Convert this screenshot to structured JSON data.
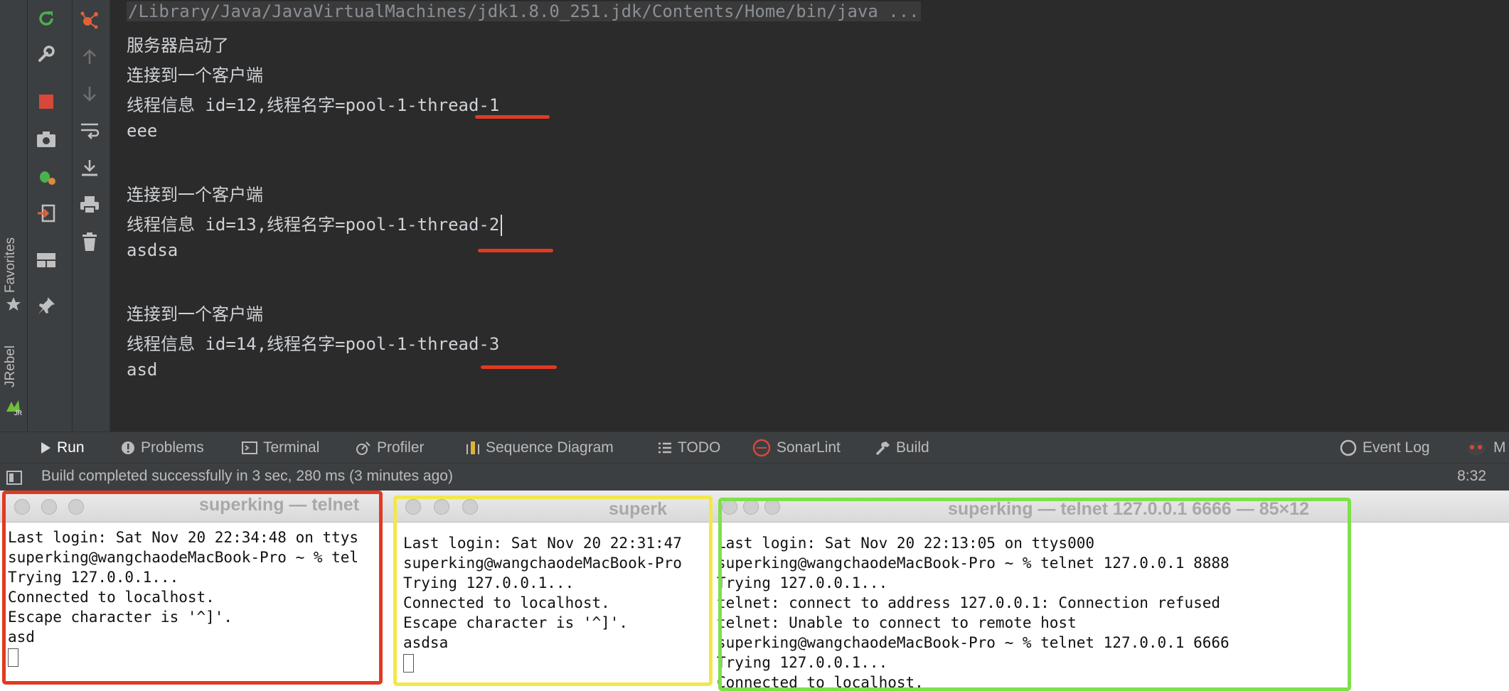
{
  "sidebar": {
    "favorites_label": "Favorites",
    "jrebel_label": "JRebel"
  },
  "console": {
    "command_line": "/Library/Java/JavaVirtualMachines/jdk1.8.0_251.jdk/Contents/Home/bin/java ...",
    "lines": [
      "服务器启动了",
      "连接到一个客户端",
      "线程信息 id=12,线程名字=pool-1-thread-1",
      "eee",
      "",
      "连接到一个客户端",
      "线程信息 id=13,线程名字=pool-1-thread-2",
      "asdsa",
      "",
      "连接到一个客户端",
      "线程信息 id=14,线程名字=pool-1-thread-3",
      "asd"
    ]
  },
  "tool_tabs": [
    "Run",
    "Problems",
    "Terminal",
    "Profiler",
    "Sequence Diagram",
    "TODO",
    "SonarLint",
    "Build"
  ],
  "right_tabs": [
    "Event Log",
    "M"
  ],
  "status": {
    "message": "Build completed successfully in 3 sec, 280 ms (3 minutes ago)",
    "time": "8:32"
  },
  "terminals": [
    {
      "title": "superking — telnet",
      "lines": [
        "Last login: Sat Nov 20 22:34:48 on ttys",
        "superking@wangchaodeMacBook-Pro ~ % tel",
        "Trying 127.0.0.1...",
        "Connected to localhost.",
        "Escape character is '^]'.",
        "asd"
      ]
    },
    {
      "title": "superk",
      "lines": [
        "Last login: Sat Nov 20 22:31:47",
        "superking@wangchaodeMacBook-Pro",
        "Trying 127.0.0.1...",
        "Connected to localhost.",
        "Escape character is '^]'.",
        "asdsa"
      ]
    },
    {
      "title": "superking — telnet 127.0.0.1 6666 — 85×12",
      "lines": [
        "Last login: Sat Nov 20 22:13:05 on ttys000",
        "superking@wangchaodeMacBook-Pro ~ % telnet 127.0.0.1 8888",
        "Trying 127.0.0.1...",
        "telnet: connect to address 127.0.0.1: Connection refused",
        "telnet: Unable to connect to remote host",
        "superking@wangchaodeMacBook-Pro ~ % telnet 127.0.0.1 6666",
        "Trying 127.0.0.1...",
        "Connected to localhost."
      ]
    }
  ],
  "colors": {
    "annotation_red": "#e13a22",
    "annotation_yellow": "#f2e74b",
    "annotation_green": "#7ee04a"
  }
}
